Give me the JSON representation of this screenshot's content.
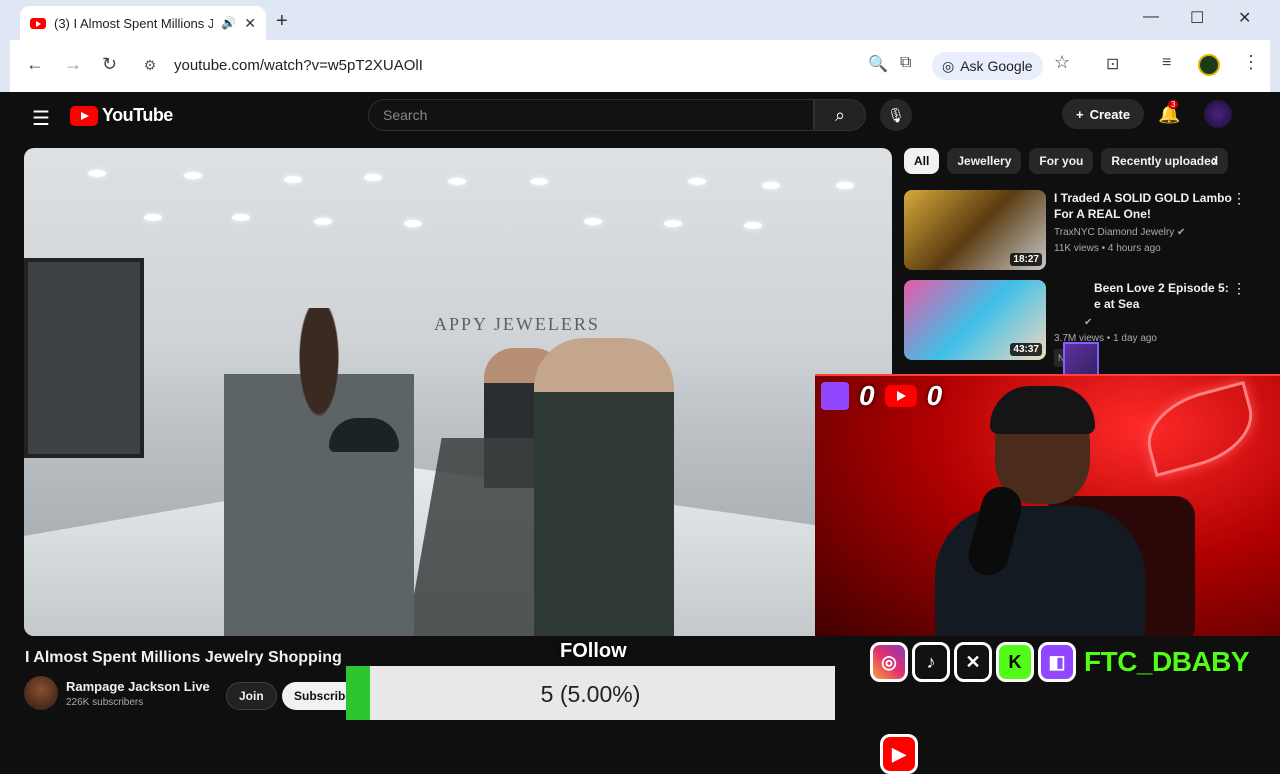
{
  "browser": {
    "tab_title": "(3) I Almost Spent Millions J",
    "address": "youtube.com/watch?v=w5pT2XUAOlI",
    "ask_google_label": "Ask Google"
  },
  "youtube": {
    "logo_text": "YouTube",
    "search_placeholder": "Search",
    "create_label": "Create",
    "notification_count": "3",
    "chips": [
      "All",
      "Jewellery",
      "For you",
      "Recently uploaded"
    ],
    "recommendations": [
      {
        "title_line1": "I Traded A SOLID GOLD Lambo",
        "title_line2": "For A REAL One!",
        "channel": "TraxNYC Diamond Jewelry",
        "meta": "11K views • 4 hours ago",
        "duration": "18:27",
        "badge": ""
      },
      {
        "title_line1": "Been Love 2 Episode 5:",
        "title_line2": "e at Sea",
        "channel": "",
        "meta": "3.7M views • 1 day ago",
        "duration": "43:37",
        "badge": "New"
      }
    ],
    "video": {
      "title": "I Almost Spent Millions Jewelry Shopping",
      "store_sign": "APPY JEWELERS",
      "channel_name": "Rampage Jackson Live",
      "subscribers": "226K subscribers",
      "join_label": "Join",
      "subscribe_label": "Subscribe"
    }
  },
  "overlay": {
    "twitch_count": "0",
    "youtube_count": "0",
    "follow_label": "FOllow",
    "follow_progress_text": "5 (5.00%)",
    "follow_progress_fraction": 0.05,
    "handle": "FTC_DBABY",
    "ftc_logo_text": "FTC"
  }
}
